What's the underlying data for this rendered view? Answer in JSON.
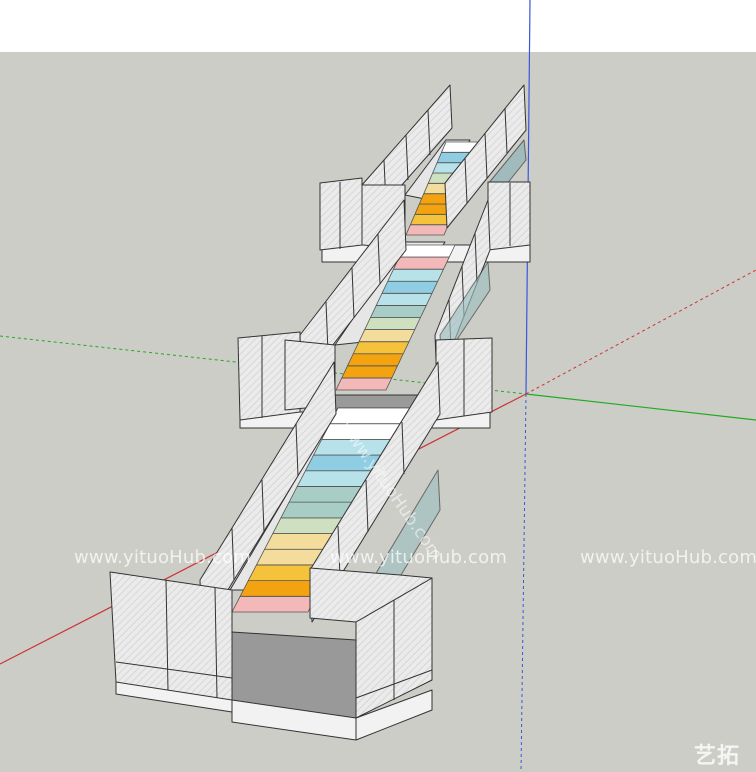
{
  "scene": {
    "subject": "staircase-3d-model",
    "background_color": "#cdcdc7",
    "sky_color": "#ffffff",
    "axis_colors": {
      "blue": "#3355dd",
      "red": "#cc3333",
      "green": "#22aa22"
    },
    "step_colors": [
      "#f3b8b8",
      "#f4a310",
      "#f5c23c",
      "#f4dc9c",
      "#cfe0c0",
      "#a8cdc4",
      "#b8e2ea",
      "#8fcde3",
      "#ffffff"
    ],
    "railing_color": "#eeeeee",
    "landing_floor_color": "#999999"
  },
  "watermarks": {
    "left": "www.yituoHub.com",
    "center": "www.yituoHub.com",
    "right": "www.yituoHub.com",
    "diagonal": "www.yituoHub.com"
  },
  "logo": {
    "text": "艺拓"
  }
}
